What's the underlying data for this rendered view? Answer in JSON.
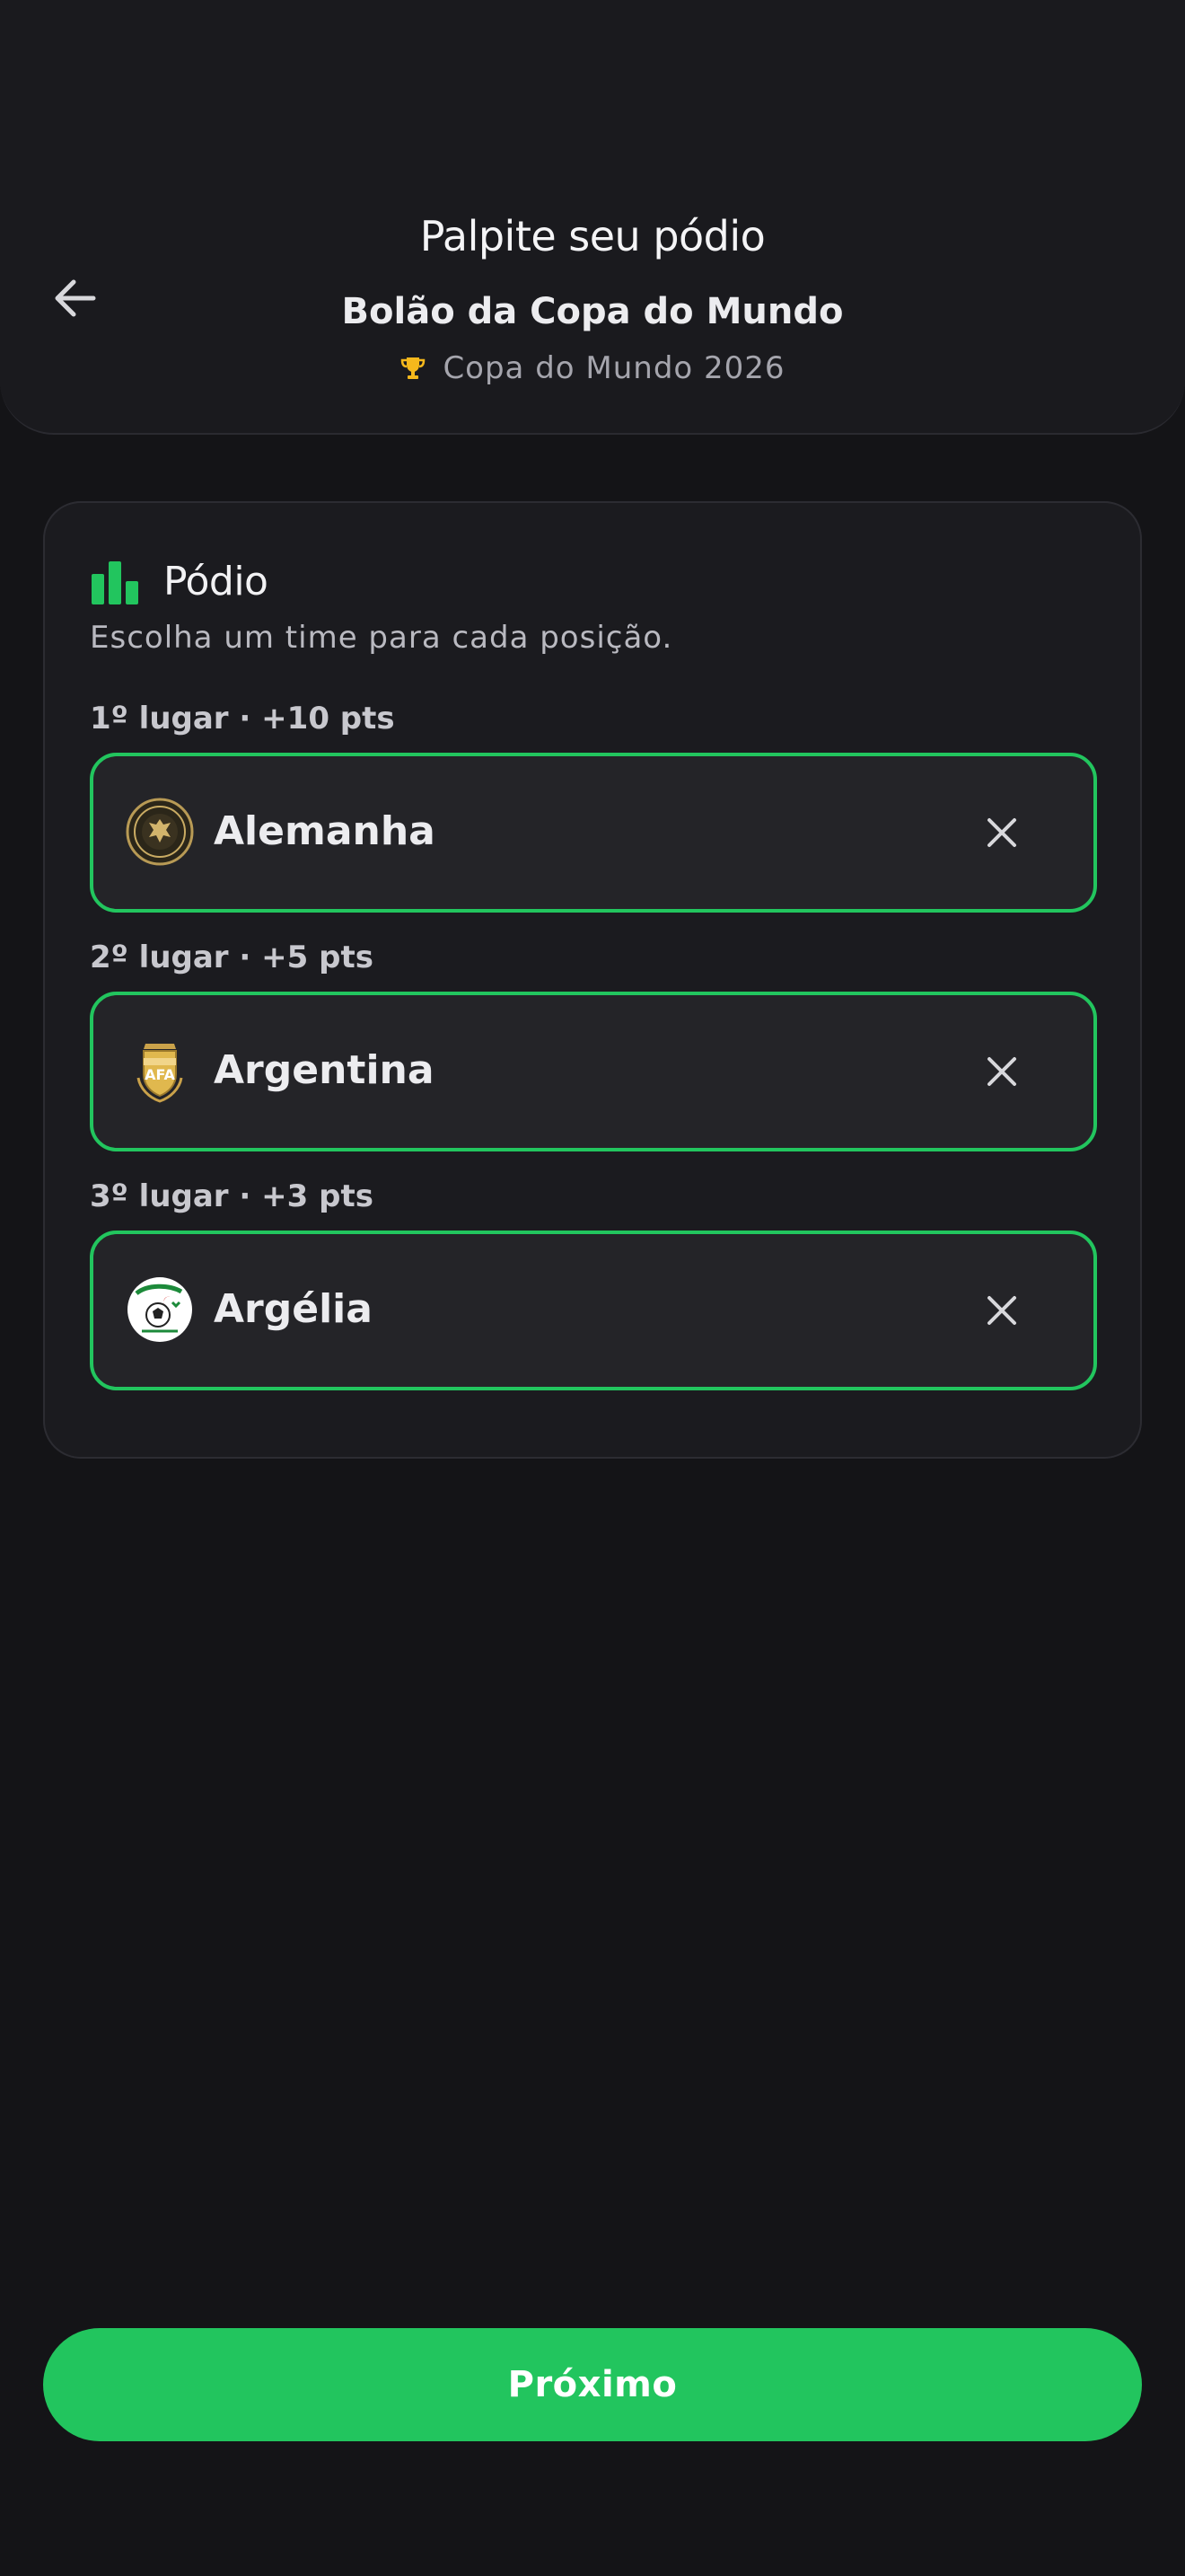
{
  "header": {
    "title": "Palpite seu pódio",
    "subtitle": "Bolão da Copa do Mundo",
    "competition": "Copa do Mundo 2026",
    "back_icon": "arrow-left-icon",
    "competition_icon": "trophy-icon"
  },
  "card": {
    "title": "Pódio",
    "title_icon": "podium-icon",
    "description": "Escolha um time para cada posição.",
    "slots": [
      {
        "label": "1º lugar · +10 pts",
        "team": "Alemanha",
        "badge_icon": "germany-crest-icon"
      },
      {
        "label": "2º lugar · +5 pts",
        "team": "Argentina",
        "badge_icon": "argentina-crest-icon"
      },
      {
        "label": "3º lugar · +3 pts",
        "team": "Argélia",
        "badge_icon": "algeria-crest-icon"
      }
    ]
  },
  "footer": {
    "next_label": "Próximo"
  },
  "colors": {
    "background": "#141417",
    "card": "#1b1b1f",
    "accent": "#22c55e",
    "trophy": "#f5b81c"
  }
}
